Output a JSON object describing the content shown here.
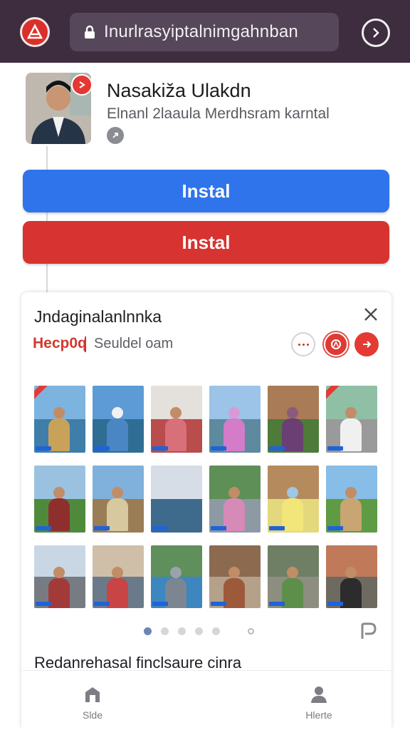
{
  "browser": {
    "url": "Inurlrasyiptalnimgahnban"
  },
  "profile": {
    "name": "Nasakiža Ulakdn",
    "subtitle": "Elnanl 2laaula Merdhsram karntal"
  },
  "buttons": {
    "install_primary": "Instal",
    "install_secondary": "Instal"
  },
  "card": {
    "title": "Jndaginalanlnnka",
    "brand": "Hecp0q",
    "brand_sub": "Seuldel oam",
    "caption": "Redanrehasal finclsaure cinra",
    "pagination": {
      "pages": 5,
      "active_index": 0
    }
  },
  "bottom_nav": {
    "left_label": "Slde",
    "right_label": "Hlerte"
  },
  "colors": {
    "topbar": "#3e2d3e",
    "primary_blue": "#2f74ea",
    "primary_red": "#d73330"
  },
  "icons": [
    "app-logo-icon",
    "lock-icon",
    "menu-icon",
    "share-icon",
    "close-icon",
    "more-icon",
    "save-icon",
    "share-action-icon",
    "home-icon",
    "profile-icon"
  ]
}
